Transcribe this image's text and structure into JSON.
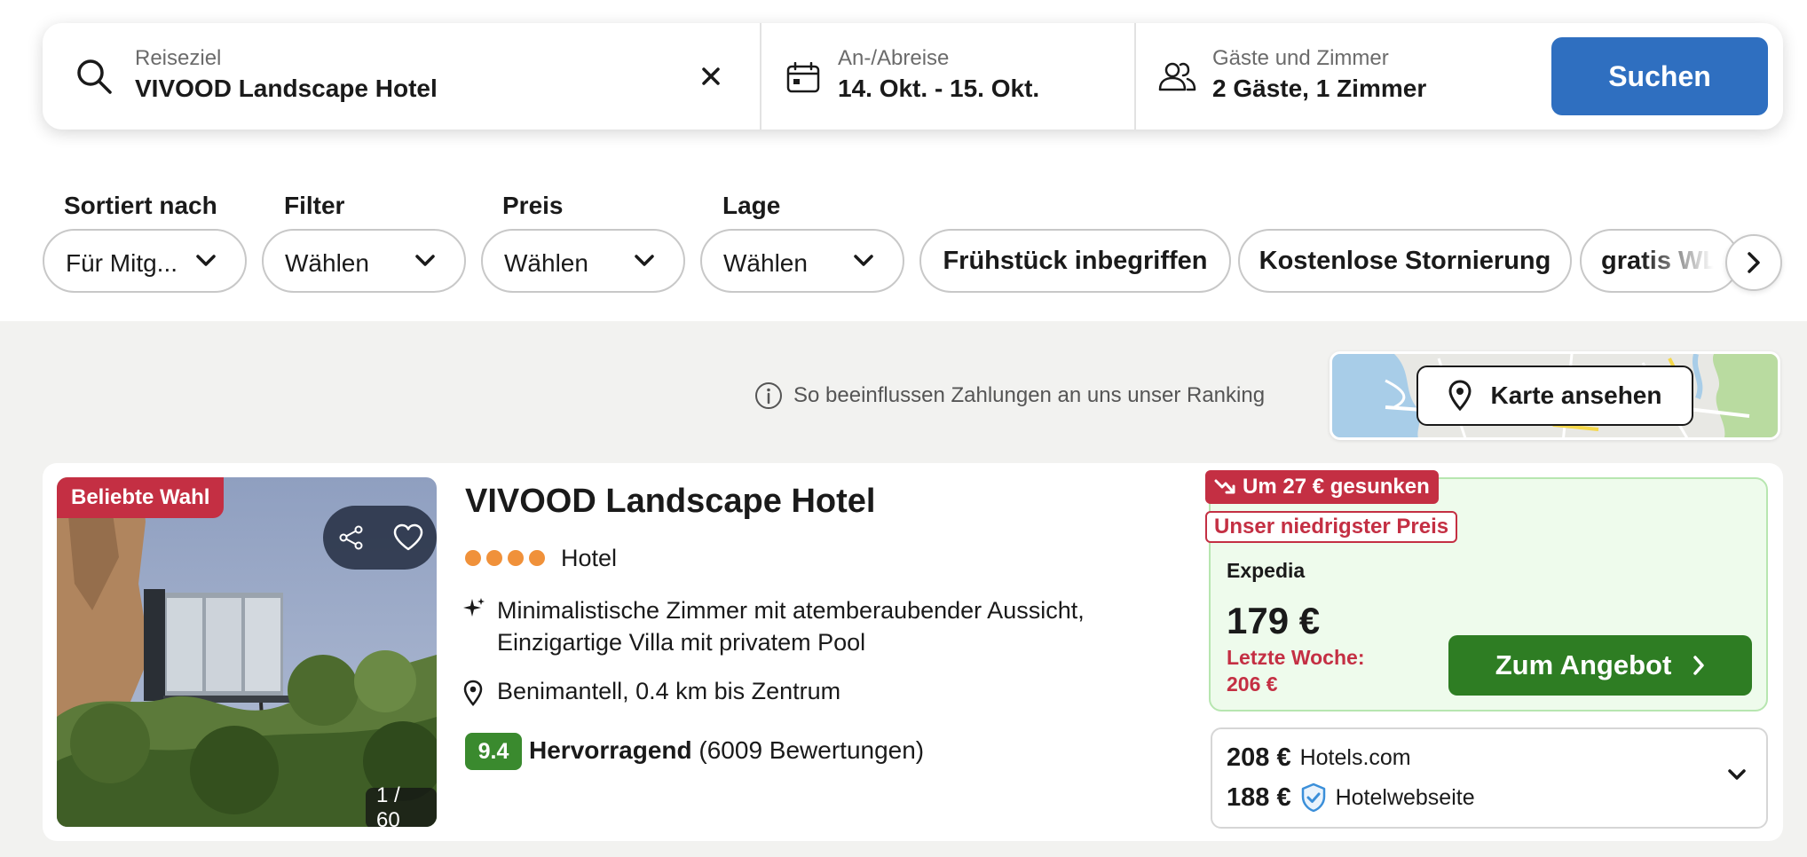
{
  "search": {
    "destination_label": "Reiseziel",
    "destination_value": "VIVOOD Landscape Hotel",
    "dates_label": "An-/Abreise",
    "dates_value": "14. Okt. - 15. Okt.",
    "guests_label": "Gäste und Zimmer",
    "guests_value": "2 Gäste, 1 Zimmer",
    "search_button": "Suchen"
  },
  "filters": {
    "sort": {
      "label": "Sortiert nach",
      "value": "Für Mitg..."
    },
    "filter": {
      "label": "Filter",
      "value": "Wählen"
    },
    "price": {
      "label": "Preis",
      "value": "Wählen"
    },
    "location": {
      "label": "Lage",
      "value": "Wählen"
    },
    "chips": [
      "Frühstück inbegriffen",
      "Kostenlose Stornierung",
      "gratis WLAN"
    ]
  },
  "ranking_info": "So beeinflussen Zahlungen an uns unser Ranking",
  "map_button": "Karte ansehen",
  "result": {
    "badge": "Beliebte Wahl",
    "photo_counter": "1 / 60",
    "name": "VIVOOD Landscape Hotel",
    "star_count": 4,
    "type": "Hotel",
    "description_line1": "Minimalistische Zimmer mit atemberaubender Aussicht,",
    "description_line2": "Einzigartige Villa mit privatem Pool",
    "location": "Benimantell, 0.4 km bis Zentrum",
    "rating_score": "9.4",
    "rating_label": "Hervorragend",
    "rating_count": "(6009 Bewertungen)",
    "price_drop_tag": "Um 27 € gesunken",
    "lowest_price_tag": "Unser niedrigster Preis",
    "provider": "Expedia",
    "price": "179 €",
    "last_week_label": "Letzte Woche:",
    "last_week_price": "206 €",
    "deal_button": "Zum Angebot",
    "other_offers": [
      {
        "price": "208 €",
        "provider": "Hotels.com"
      },
      {
        "price": "188 €",
        "provider": "Hotelwebseite"
      }
    ]
  },
  "colors": {
    "primary_blue": "#2f6fc0",
    "deal_green": "#2e7d23",
    "rating_green": "#3a8a2e",
    "alert_red": "#c42f43",
    "star_orange": "#f0913a"
  },
  "icons": [
    "search-icon",
    "clear-icon",
    "calendar-icon",
    "guests-icon",
    "chevron-down-icon",
    "chevron-right-icon",
    "info-icon",
    "map-pin-icon",
    "share-icon",
    "heart-icon",
    "sparkle-icon",
    "location-pin-icon",
    "trend-down-icon",
    "shield-check-icon"
  ]
}
